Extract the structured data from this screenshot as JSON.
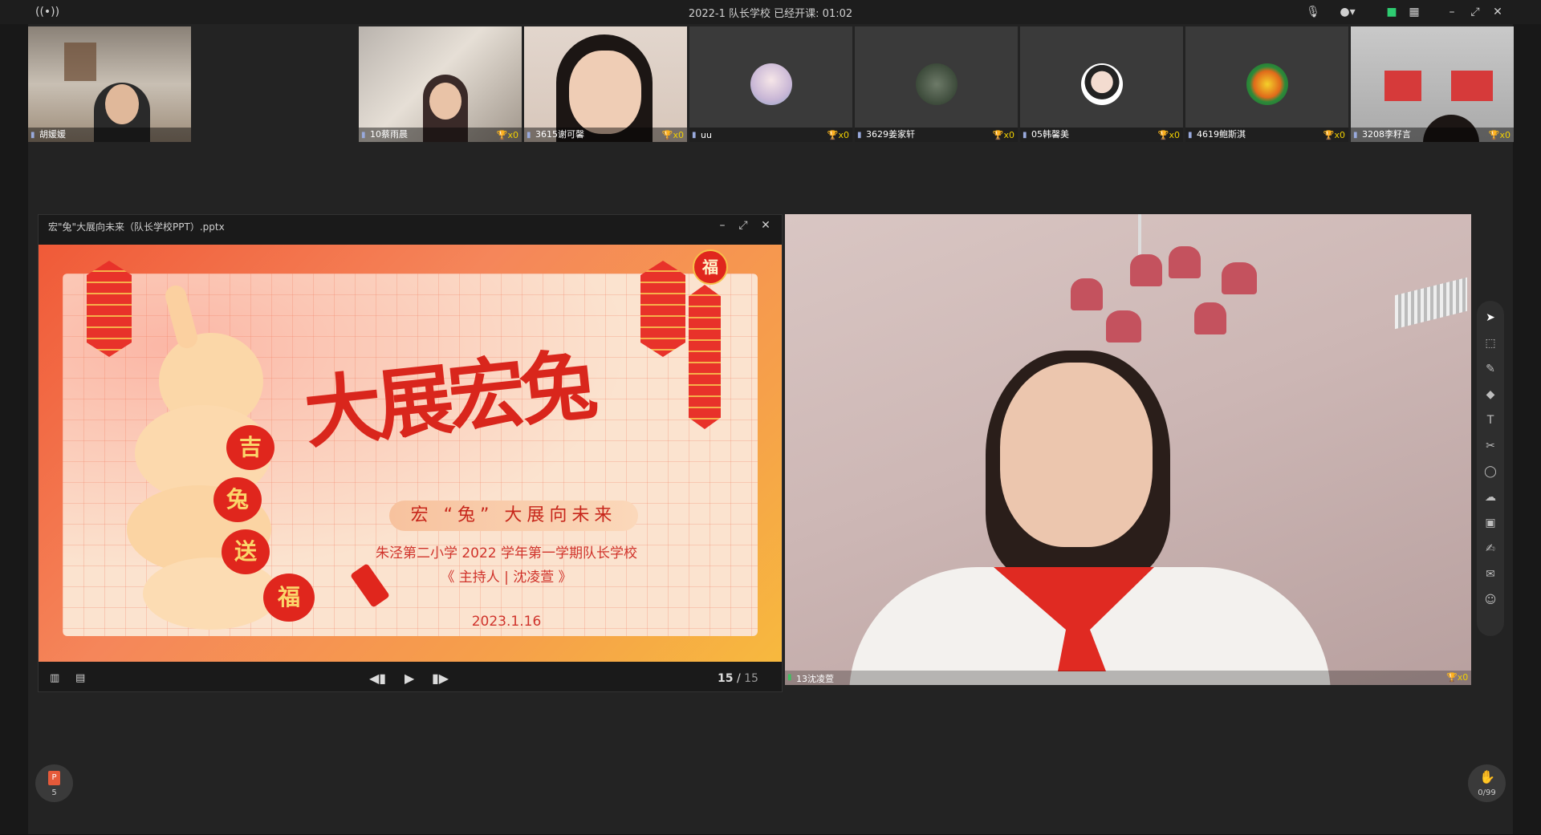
{
  "titlebar": {
    "title": "2022-1 队长学校    已经开课: 01:02",
    "signal_icon": "broadcast-icon",
    "mic_icon": "mic-icon",
    "camera_icon": "camera-icon",
    "layout_icon": "grid-icon",
    "minimize": "–",
    "restore": "⤢",
    "close": "✕"
  },
  "participants": [
    {
      "name": "胡媛媛",
      "trophy": ""
    },
    {
      "name": "10蔡雨晨",
      "trophy": "x0"
    },
    {
      "name": "3615谢可馨",
      "trophy": "x0"
    },
    {
      "name": "uu",
      "trophy": "x0"
    },
    {
      "name": "3629姜家轩",
      "trophy": "x0"
    },
    {
      "name": "05韩馨美",
      "trophy": "x0"
    },
    {
      "name": "4619鲍斯淇",
      "trophy": "x0"
    },
    {
      "name": "3208李籽言",
      "trophy": "x0"
    }
  ],
  "ppt_window": {
    "title": "宏\"兔\"大展向未来（队长学校PPT）.pptx",
    "minimize": "–",
    "maximize": "⤢",
    "close": "✕",
    "slide": {
      "big_title": "大展宏兔",
      "fu": "福",
      "subtitle": "宏 “兔” 大展向未来",
      "school_line": "朱泾第二小学  2022  学年第一学期队长学校",
      "host_line": "《 主持人 | 沈凌萱 》",
      "date": "2023.1.16",
      "lantern_chars": [
        "吉",
        "兔",
        "送",
        "福"
      ]
    },
    "controls": {
      "current_page": "15",
      "separator": "/",
      "total_pages": "15"
    }
  },
  "main_video": {
    "name": "13沈凌萱",
    "trophy": "x0"
  },
  "toolbar_icons": [
    "cursor-icon",
    "select-icon",
    "pen-icon",
    "eraser-icon",
    "text-icon",
    "scissors-icon",
    "shape-icon",
    "cloud-icon",
    "toolbox-icon",
    "edit-icon",
    "chat-icon",
    "users-icon"
  ],
  "bottom": {
    "ppt_count": "5",
    "ppt_badge": "P",
    "hand_count": "0/99"
  }
}
